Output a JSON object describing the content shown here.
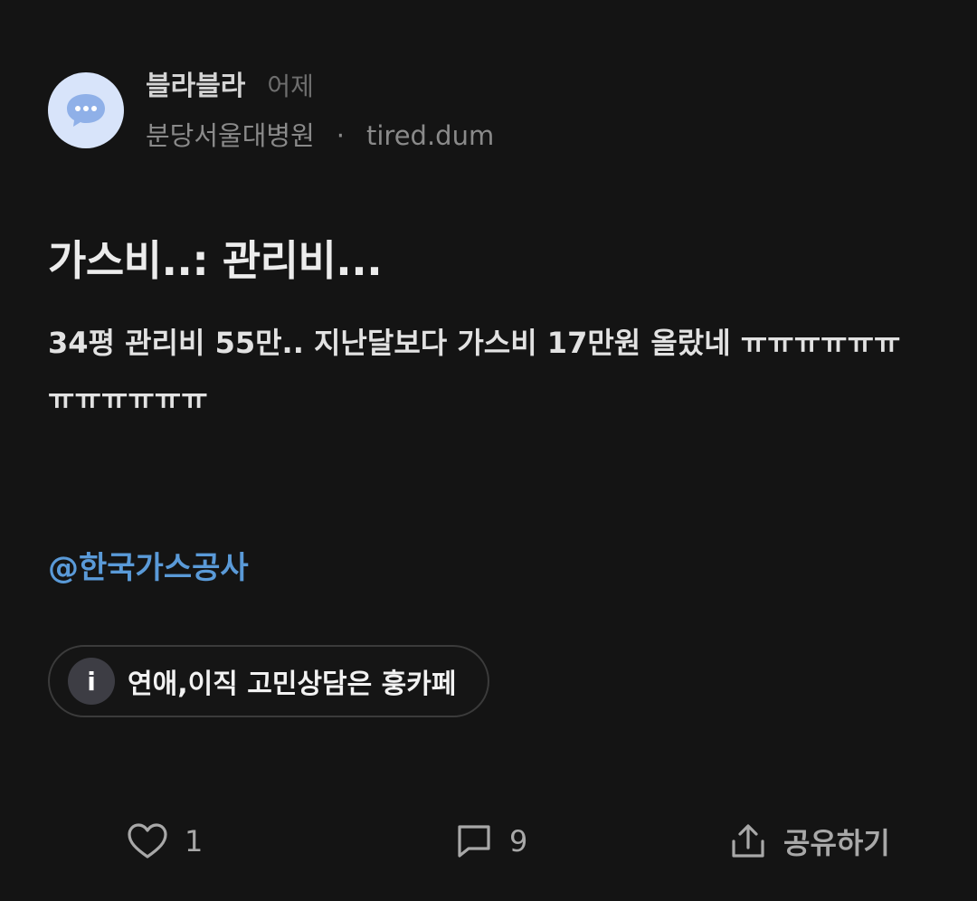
{
  "post": {
    "author": {
      "name": "블라블라",
      "time": "어제",
      "company": "분당서울대병원",
      "separator": "·",
      "nickname": "tired.dum",
      "avatar_icon": "chat-bubble-icon",
      "avatar_color": "#d8e4fa"
    },
    "title": "가스비..: 관리비...",
    "body": "34평 관리비 55만.. 지난달보다 가스비 17만원 올랐네 ㅠㅠㅠㅠㅠㅠㅠㅠㅠㅠㅠㅠ",
    "mention": "@한국가스공사",
    "mention_color": "#5a9ad8",
    "chip": {
      "icon_glyph": "i",
      "icon": "info-icon",
      "label": "연애,이직 고민상담은 훙카페"
    }
  },
  "actions": {
    "like": {
      "icon": "heart-icon",
      "count": "1"
    },
    "comment": {
      "icon": "comment-icon",
      "count": "9"
    },
    "share": {
      "icon": "share-icon",
      "label": "공유하기"
    }
  }
}
